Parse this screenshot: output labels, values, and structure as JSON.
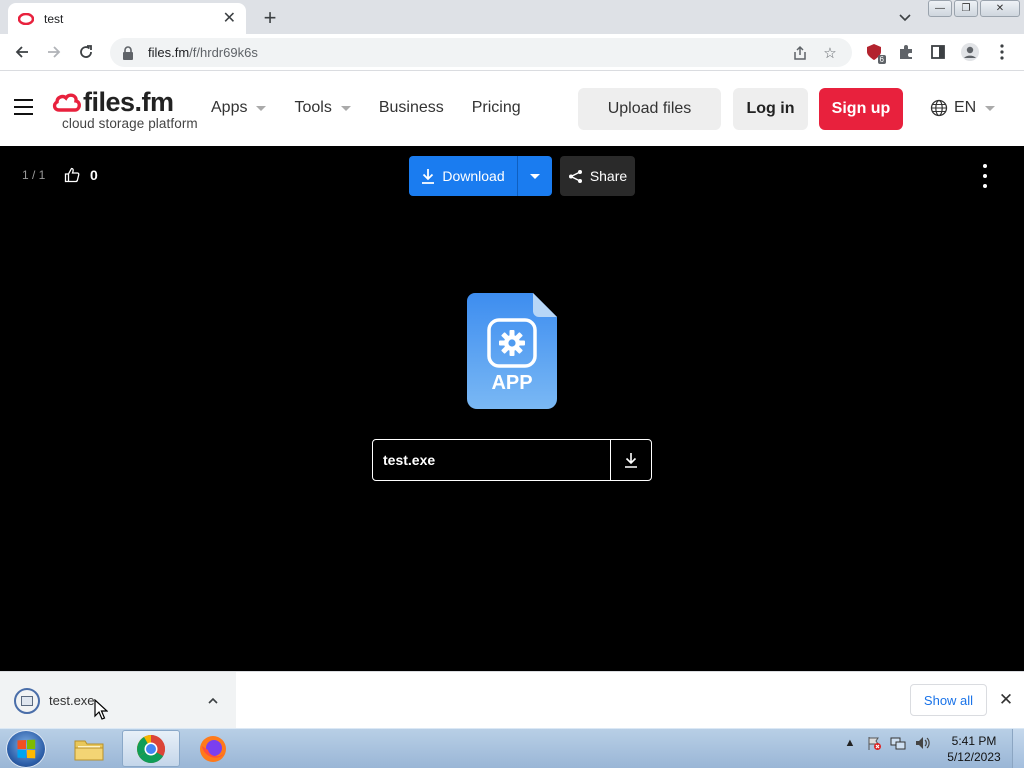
{
  "browser": {
    "tab_title": "test",
    "url_domain": "files.fm",
    "url_path": "/f/hrdr69k6s",
    "extension_badge": "6"
  },
  "site": {
    "logo_text": "files.fm",
    "logo_sub": "cloud storage platform",
    "nav": [
      "Apps",
      "Tools",
      "Business",
      "Pricing"
    ],
    "upload_label": "Upload files",
    "login_label": "Log in",
    "signup_label": "Sign up",
    "language": "EN",
    "colors": {
      "brand_red": "#e8213d",
      "download_blue": "#1a7cf0"
    }
  },
  "viewer": {
    "counter": "1 / 1",
    "likes": "0",
    "download_label": "Download",
    "share_label": "Share",
    "file_type_label": "APP",
    "file_name": "test.exe"
  },
  "download_shelf": {
    "item_name": "test.exe",
    "show_all_label": "Show all"
  },
  "taskbar": {
    "apps": [
      "explorer-icon",
      "chrome-icon",
      "firefox-icon"
    ],
    "time": "5:41 PM",
    "date": "5/12/2023"
  }
}
